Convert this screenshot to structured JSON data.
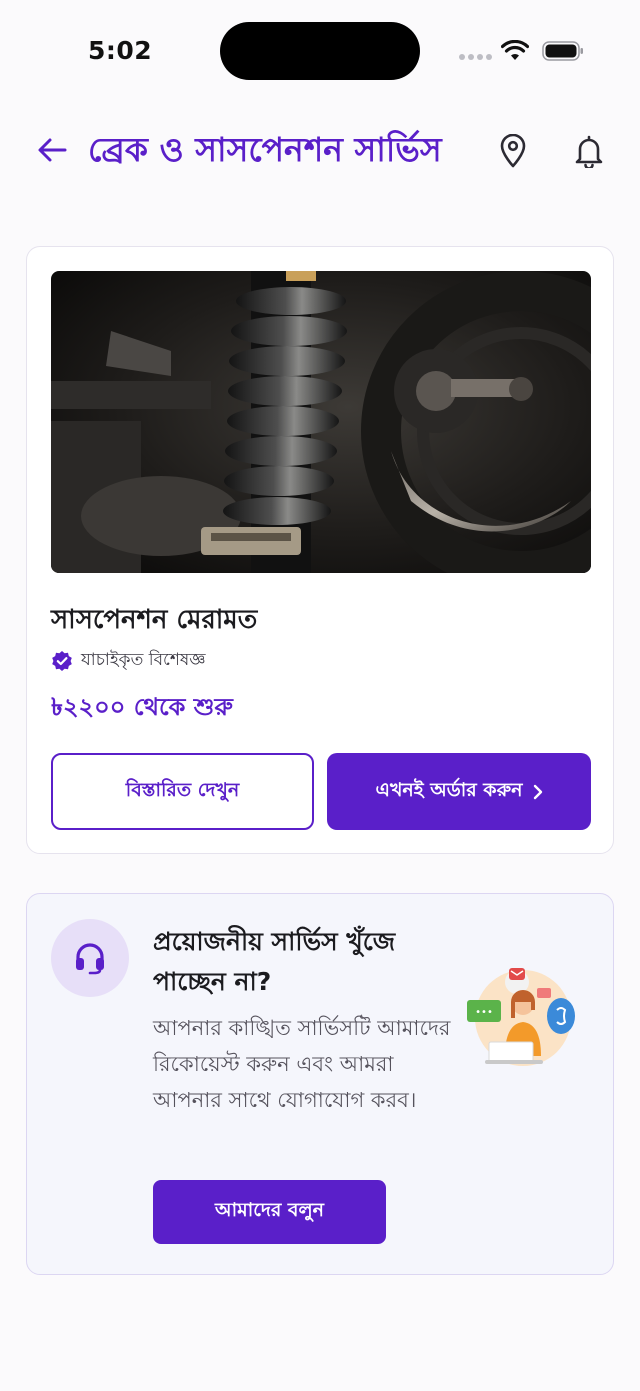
{
  "status_bar": {
    "time": "5:02"
  },
  "header": {
    "title": "ব্রেক ও সাসপেনশন সার্ভিস"
  },
  "service": {
    "name": "সাসপেনশন মেরামত",
    "verified_label": "যাচাইকৃত বিশেষজ্ঞ",
    "price_text": "৳২২০০ থেকে শুরু",
    "details_button": "বিস্তারিত দেখুন",
    "order_button": "এখনই অর্ডার করুন"
  },
  "help": {
    "title": "প্রয়োজনীয় সার্ভিস  খুঁজে পাচ্ছেন না?",
    "description": "আপনার কাঙ্খিত সার্ভিসটি আমাদের রিকোয়েস্ট করুন এবং আমরা আপনার সাথে যোগাযোগ করব।",
    "button": "আমাদের বলুন"
  },
  "colors": {
    "accent": "#5a1fc9",
    "accent_light": "#e7dff8"
  },
  "icons": [
    "back-arrow-icon",
    "location-pin-icon",
    "bell-icon",
    "verified-badge-icon",
    "chevron-right-icon",
    "headset-icon"
  ]
}
